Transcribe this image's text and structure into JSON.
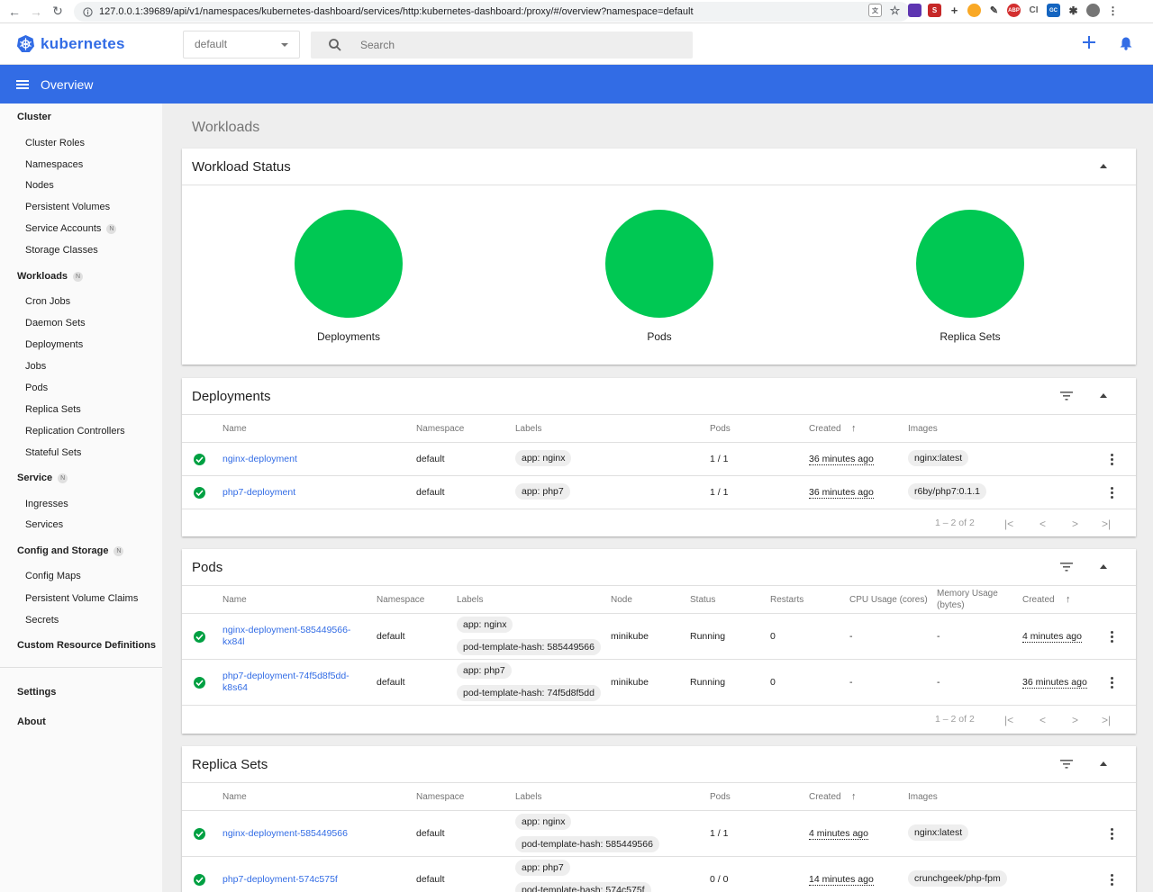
{
  "browser": {
    "url": "127.0.0.1:39689/api/v1/namespaces/kubernetes-dashboard/services/http:kubernetes-dashboard:/proxy/#/overview?namespace=default"
  },
  "app": {
    "logo_text": "kubernetes",
    "namespace": "default",
    "search_placeholder": "Search",
    "page_title": "Overview"
  },
  "sidebar": {
    "cluster": "Cluster",
    "cluster_items": [
      "Cluster Roles",
      "Namespaces",
      "Nodes",
      "Persistent Volumes",
      "Service Accounts",
      "Storage Classes"
    ],
    "workloads": "Workloads",
    "workload_items": [
      "Cron Jobs",
      "Daemon Sets",
      "Deployments",
      "Jobs",
      "Pods",
      "Replica Sets",
      "Replication Controllers",
      "Stateful Sets"
    ],
    "service": "Service",
    "service_items": [
      "Ingresses",
      "Services"
    ],
    "config": "Config and Storage",
    "config_items": [
      "Config Maps",
      "Persistent Volume Claims",
      "Secrets"
    ],
    "crd": "Custom Resource Definitions",
    "settings": "Settings",
    "about": "About",
    "badge": "N"
  },
  "main": {
    "section": "Workloads",
    "workload_status": {
      "title": "Workload Status",
      "items": [
        "Deployments",
        "Pods",
        "Replica Sets"
      ],
      "color": "#00c853"
    },
    "deployments": {
      "title": "Deployments",
      "headers": [
        "Name",
        "Namespace",
        "Labels",
        "Pods",
        "Created",
        "Images"
      ],
      "rows": [
        {
          "name": "nginx-deployment",
          "namespace": "default",
          "label": "app: nginx",
          "pods": "1 / 1",
          "created": "36 minutes ago",
          "image": "nginx:latest"
        },
        {
          "name": "php7-deployment",
          "namespace": "default",
          "label": "app: php7",
          "pods": "1 / 1",
          "created": "36 minutes ago",
          "image": "r6by/php7:0.1.1"
        }
      ],
      "pager": "1 – 2 of 2"
    },
    "pods": {
      "title": "Pods",
      "headers": [
        "Name",
        "Namespace",
        "Labels",
        "Node",
        "Status",
        "Restarts",
        "CPU Usage (cores)",
        "Memory Usage",
        "(bytes)",
        "Created"
      ],
      "rows": [
        {
          "name1": "nginx-deployment-585449566-",
          "name2": "kx84l",
          "namespace": "default",
          "label1": "app: nginx",
          "label2": "pod-template-hash: 585449566",
          "node": "minikube",
          "status": "Running",
          "restarts": "0",
          "cpu": "-",
          "mem": "-",
          "created": "4 minutes ago"
        },
        {
          "name1": "php7-deployment-74f5d8f5dd-",
          "name2": "k8s64",
          "namespace": "default",
          "label1": "app: php7",
          "label2": "pod-template-hash: 74f5d8f5dd",
          "node": "minikube",
          "status": "Running",
          "restarts": "0",
          "cpu": "-",
          "mem": "-",
          "created": "36 minutes ago"
        }
      ],
      "pager": "1 – 2 of 2"
    },
    "replicasets": {
      "title": "Replica Sets",
      "headers": [
        "Name",
        "Namespace",
        "Labels",
        "Pods",
        "Created",
        "Images"
      ],
      "rows": [
        {
          "name": "nginx-deployment-585449566",
          "namespace": "default",
          "label1": "app: nginx",
          "label2": "pod-template-hash: 585449566",
          "pods": "1 / 1",
          "created": "4 minutes ago",
          "image": "nginx:latest"
        },
        {
          "name": "php7-deployment-574c575f",
          "namespace": "default",
          "label1": "app: php7",
          "label2": "pod-template-hash: 574c575f",
          "pods": "0 / 0",
          "created": "14 minutes ago",
          "image": "crunchgeek/php-fpm"
        }
      ]
    }
  }
}
